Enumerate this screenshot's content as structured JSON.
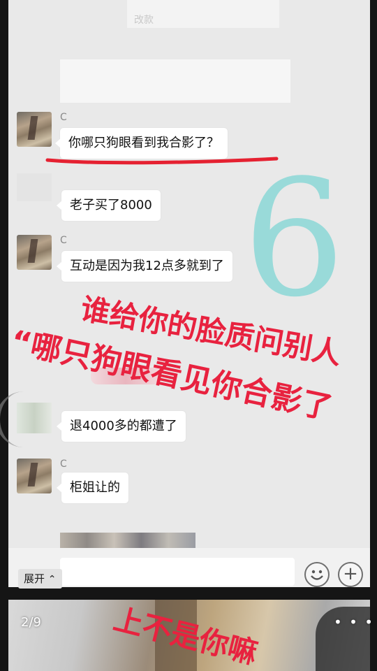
{
  "chat": {
    "messages": [
      {
        "sender": "C",
        "text": "你哪只狗眼看到我合影了？"
      },
      {
        "sender": "",
        "text": "老子买了8000"
      },
      {
        "sender": "C",
        "text": "互动是因为我12点多就到了"
      },
      {
        "sender": "",
        "text": "退4000多的都遭了"
      },
      {
        "sender": "C",
        "text": "柜姐让的"
      }
    ],
    "top_partial_text": "改款"
  },
  "overlay": {
    "line1": "谁给你的脸质问别人",
    "line2": "“哪只狗眼看见你合影了",
    "bottom_text": "上不是你嘛",
    "watermark_number": "6",
    "colors": {
      "overlay_red": "#e8223f",
      "underline_red": "#e52131",
      "watermark_teal": "#7fd6d4"
    }
  },
  "toolbar": {
    "expand_label": "展开",
    "expand_icon": "chevron-up-icon",
    "emoji_icon": "smiley-icon",
    "add_label": "+"
  },
  "viewer": {
    "page_indicator": "2/9",
    "more_label": "• • •"
  }
}
